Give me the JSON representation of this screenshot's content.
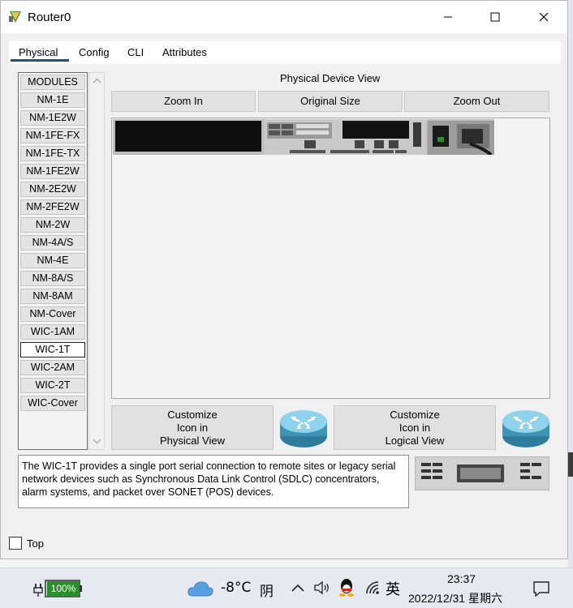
{
  "window": {
    "title": "Router0"
  },
  "tabs": [
    {
      "label": "Physical",
      "active": true
    },
    {
      "label": "Config"
    },
    {
      "label": "CLI"
    },
    {
      "label": "Attributes"
    }
  ],
  "modules": {
    "items": [
      "MODULES",
      "NM-1E",
      "NM-1E2W",
      "NM-1FE-FX",
      "NM-1FE-TX",
      "NM-1FE2W",
      "NM-2E2W",
      "NM-2FE2W",
      "NM-2W",
      "NM-4A/S",
      "NM-4E",
      "NM-8A/S",
      "NM-8AM",
      "NM-Cover",
      "WIC-1AM",
      "WIC-1T",
      "WIC-2AM",
      "WIC-2T",
      "WIC-Cover"
    ],
    "selected": "WIC-1T"
  },
  "physical_view": {
    "label": "Physical Device View",
    "zoom_in": "Zoom In",
    "original_size": "Original Size",
    "zoom_out": "Zoom Out"
  },
  "customize": {
    "physical": [
      "Customize",
      "Icon in",
      "Physical View"
    ],
    "logical": [
      "Customize",
      "Icon in",
      "Logical View"
    ]
  },
  "description": "The WIC-1T provides a single port serial connection to remote sites or legacy serial network devices such as Synchronous Data Link Control (SDLC) concentrators, alarm systems, and packet over SONET (POS) devices.",
  "top_checkbox": {
    "label": "Top",
    "checked": false
  },
  "taskbar": {
    "battery": "100%",
    "temperature": "-8°C",
    "weather": "阴",
    "ime": "英",
    "time": "23:37",
    "date": "2022/12/31 星期六"
  },
  "colors": {
    "tab_underline": "#1e4e8c",
    "battery": "#2a8f2a"
  }
}
